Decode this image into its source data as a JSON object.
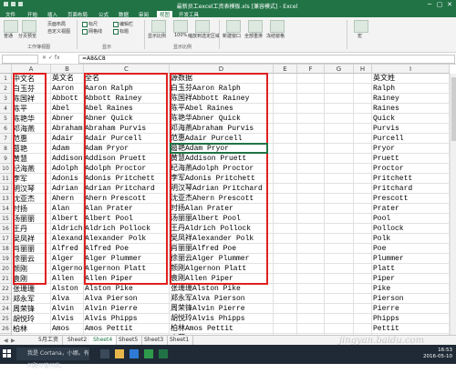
{
  "window": {
    "title": "最新员工excel工资表模板.xls [兼容模式] - Excel",
    "min": "─",
    "max": "▢",
    "close": "✕"
  },
  "ribbon_tabs": [
    "文件",
    "开始",
    "插入",
    "页面布局",
    "公式",
    "数据",
    "审阅",
    "视图",
    "开发工具"
  ],
  "active_tab": "视图",
  "ribbon": {
    "views": [
      "普通",
      "分页预览",
      "页面布局",
      "自定义视图"
    ],
    "views_group": "工作簿视图",
    "show_items": [
      "标尺",
      "编辑栏",
      "网格线",
      "标题"
    ],
    "show_group": "显示",
    "zoom_items": [
      "显示比例",
      "100%",
      "缩放到选定区域"
    ],
    "zoom_group": "显示比例",
    "window_items": [
      "新建窗口",
      "全部重排",
      "冻结窗格"
    ],
    "macro_items": [
      "宏"
    ]
  },
  "formula_bar": {
    "namebox": "",
    "fx": "fx",
    "formula": "=A8&C8"
  },
  "columns": [
    "A",
    "B",
    "C",
    "D",
    "E",
    "F",
    "G",
    "H",
    "I"
  ],
  "rows": [
    {
      "n": "1",
      "a": "中文名",
      "b": "英文名",
      "c": "全名",
      "d": "源数据",
      "i": "英文姓"
    },
    {
      "n": "2",
      "a": "白玉芬",
      "b": "Aaron",
      "c": "Aaron Ralph",
      "d": "白玉芬Aaron Ralph",
      "i": "Ralph"
    },
    {
      "n": "3",
      "a": "陈国祥",
      "b": "Abbott",
      "c": "Abbott Rainey",
      "d": "陈国祥Abbott Rainey",
      "i": "Rainey"
    },
    {
      "n": "4",
      "a": "陈平",
      "b": "Abel",
      "c": "Abel Raines",
      "d": "陈平Abel Raines",
      "i": "Raines"
    },
    {
      "n": "5",
      "a": "陈艳华",
      "b": "Abner",
      "c": "Abner Quick",
      "d": "陈艳华Abner Quick",
      "i": "Quick"
    },
    {
      "n": "6",
      "a": "邓海燕",
      "b": "Abraham",
      "c": "Abraham Purvis",
      "d": "邓海燕Abraham Purvis",
      "i": "Purvis"
    },
    {
      "n": "7",
      "a": "范惠",
      "b": "Adair",
      "c": "Adair Purcell",
      "d": "范惠Adair Purcell",
      "i": "Purcell"
    },
    {
      "n": "8",
      "a": "葛艳",
      "b": "Adam",
      "c": "Adam Pryor",
      "d": "葛艳Adam Pryor",
      "i": "Pryor"
    },
    {
      "n": "9",
      "a": "黄慧",
      "b": "Addison",
      "c": "Addison Pruett",
      "d": "黄慧Addison Pruett",
      "i": "Pruett"
    },
    {
      "n": "10",
      "a": "纪海燕",
      "b": "Adolph",
      "c": "Adolph Proctor",
      "d": "纪海燕Adolph Proctor",
      "i": "Proctor"
    },
    {
      "n": "11",
      "a": "李军",
      "b": "Adonis",
      "c": "Adonis Pritchett",
      "d": "李军Adonis Pritchett",
      "i": "Pritchett"
    },
    {
      "n": "12",
      "a": "明汉琴",
      "b": "Adrian",
      "c": "Adrian Pritchard",
      "d": "明汉琴Adrian Pritchard",
      "i": "Pritchard"
    },
    {
      "n": "13",
      "a": "沈亚杰",
      "b": "Ahern",
      "c": "Ahern Prescott",
      "d": "沈亚杰Ahern Prescott",
      "i": "Prescott"
    },
    {
      "n": "14",
      "a": "时扬",
      "b": "Alan",
      "c": "Alan Prater",
      "d": "时扬Alan Prater",
      "i": "Prater"
    },
    {
      "n": "15",
      "a": "汤丽丽",
      "b": "Albert",
      "c": "Albert Pool",
      "d": "汤丽丽Albert Pool",
      "i": "Pool"
    },
    {
      "n": "16",
      "a": "王丹",
      "b": "Aldrich",
      "c": "Aldrich Pollock",
      "d": "王丹Aldrich Pollock",
      "i": "Pollock"
    },
    {
      "n": "17",
      "a": "吴凤祥",
      "b": "Alexander",
      "c": "Alexander Polk",
      "d": "吴凤祥Alexander Polk",
      "i": "Polk"
    },
    {
      "n": "18",
      "a": "肖丽丽",
      "b": "Alfred",
      "c": "Alfred Poe",
      "d": "肖丽丽Alfred Poe",
      "i": "Poe"
    },
    {
      "n": "19",
      "a": "徐丽云",
      "b": "Alger",
      "c": "Alger Plummer",
      "d": "徐丽云Alger Plummer",
      "i": "Plummer"
    },
    {
      "n": "20",
      "a": "颜刚",
      "b": "Algernon",
      "c": "Algernon Platt",
      "d": "颜刚Algernon Platt",
      "i": "Platt"
    },
    {
      "n": "21",
      "a": "袁刚",
      "b": "Allen",
      "c": "Allen Piper",
      "d": "袁刚Allen Piper",
      "i": "Piper"
    },
    {
      "n": "22",
      "a": "张珊珊",
      "b": "Alston",
      "c": "Alston Pike",
      "d": "张珊珊Alston Pike",
      "i": "Pike"
    },
    {
      "n": "23",
      "a": "郑永军",
      "b": "Alva",
      "c": "Alva Pierson",
      "d": "郑永军Alva Pierson",
      "i": "Pierson"
    },
    {
      "n": "24",
      "a": "周荣锋",
      "b": "Alvin",
      "c": "Alvin Pierre",
      "d": "周荣锋Alvin Pierre",
      "i": "Pierre"
    },
    {
      "n": "25",
      "a": "胡悦玲",
      "b": "Alvis",
      "c": "Alvis Phipps",
      "d": "胡悦玲Alvis Phipps",
      "i": "Phipps"
    },
    {
      "n": "26",
      "a": "柏林",
      "b": "Amos",
      "c": "Amos Pettit",
      "d": "柏林Amos Pettit",
      "i": "Pettit"
    },
    {
      "n": "27",
      "a": "仓莉",
      "b": "Andre",
      "c": "Andre Perdue",
      "d": "仓莉Andre Perdue",
      "i": "Perdue"
    }
  ],
  "sheet_tabs": [
    "5月工资",
    "Sheet2",
    "Sheet4",
    "Sheet5",
    "Sheet3",
    "Sheet1"
  ],
  "active_sheet": "Sheet4",
  "taskbar": {
    "search_placeholder": "我是 Cortana，小娜。有问题尽管问我。",
    "time": "16:53",
    "date": "2016-05-10"
  },
  "watermark": "jingyan.baidu.com",
  "colors": {
    "excel_green": "#217346",
    "highlight_red": "#e02020"
  }
}
